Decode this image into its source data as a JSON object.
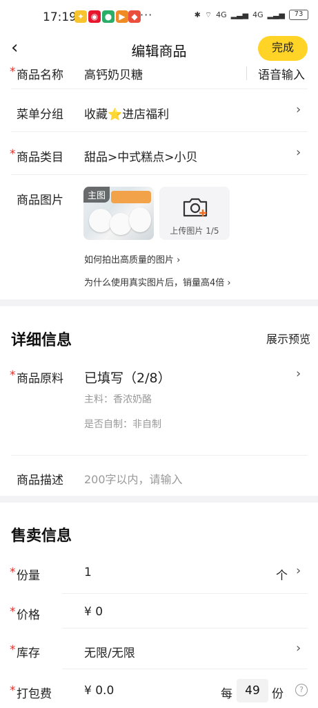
{
  "status_bar": {
    "time": "17:19",
    "battery": "73",
    "network1": "4G",
    "network2": "4G"
  },
  "header": {
    "title": "编辑商品",
    "done_label": "完成"
  },
  "basic": {
    "name_label": "商品名称",
    "name_value": "高钙奶贝糖",
    "voice_input": "语音输入",
    "menu_group_label": "菜单分组",
    "menu_group_value": "收藏⭐进店福利",
    "category_label": "商品类目",
    "category_value": "甜品>中式糕点>小贝",
    "image_label": "商品图片",
    "main_image_tag": "主图",
    "upload_label": "上传图片 1/5",
    "tip_quality": "如何拍出高质量的图片",
    "tip_real": "为什么使用真实图片后，销量高4倍"
  },
  "detail": {
    "title": "详细信息",
    "preview": "展示预览",
    "ingredients_label": "商品原料",
    "ingredients_value": "已填写（2/8）",
    "main_ingredient": "主料：香浓奶酪",
    "homemade": "是否自制：非自制",
    "desc_label": "商品描述",
    "desc_placeholder": "200字以内，请输入"
  },
  "sale": {
    "title": "售卖信息",
    "portion_label": "份量",
    "portion_value": "1",
    "portion_unit": "个",
    "price_label": "价格",
    "price_value": "¥ 0",
    "stock_label": "库存",
    "stock_value": "无限/无限",
    "packing_label": "打包费",
    "packing_value": "¥ 0.0",
    "packing_per": "每",
    "packing_count": "49",
    "packing_unit": "份",
    "help_icon": "?"
  },
  "colors": {
    "accent": "#FFD426",
    "required": "#E5312A",
    "section_bg": "#F3F3F5"
  }
}
